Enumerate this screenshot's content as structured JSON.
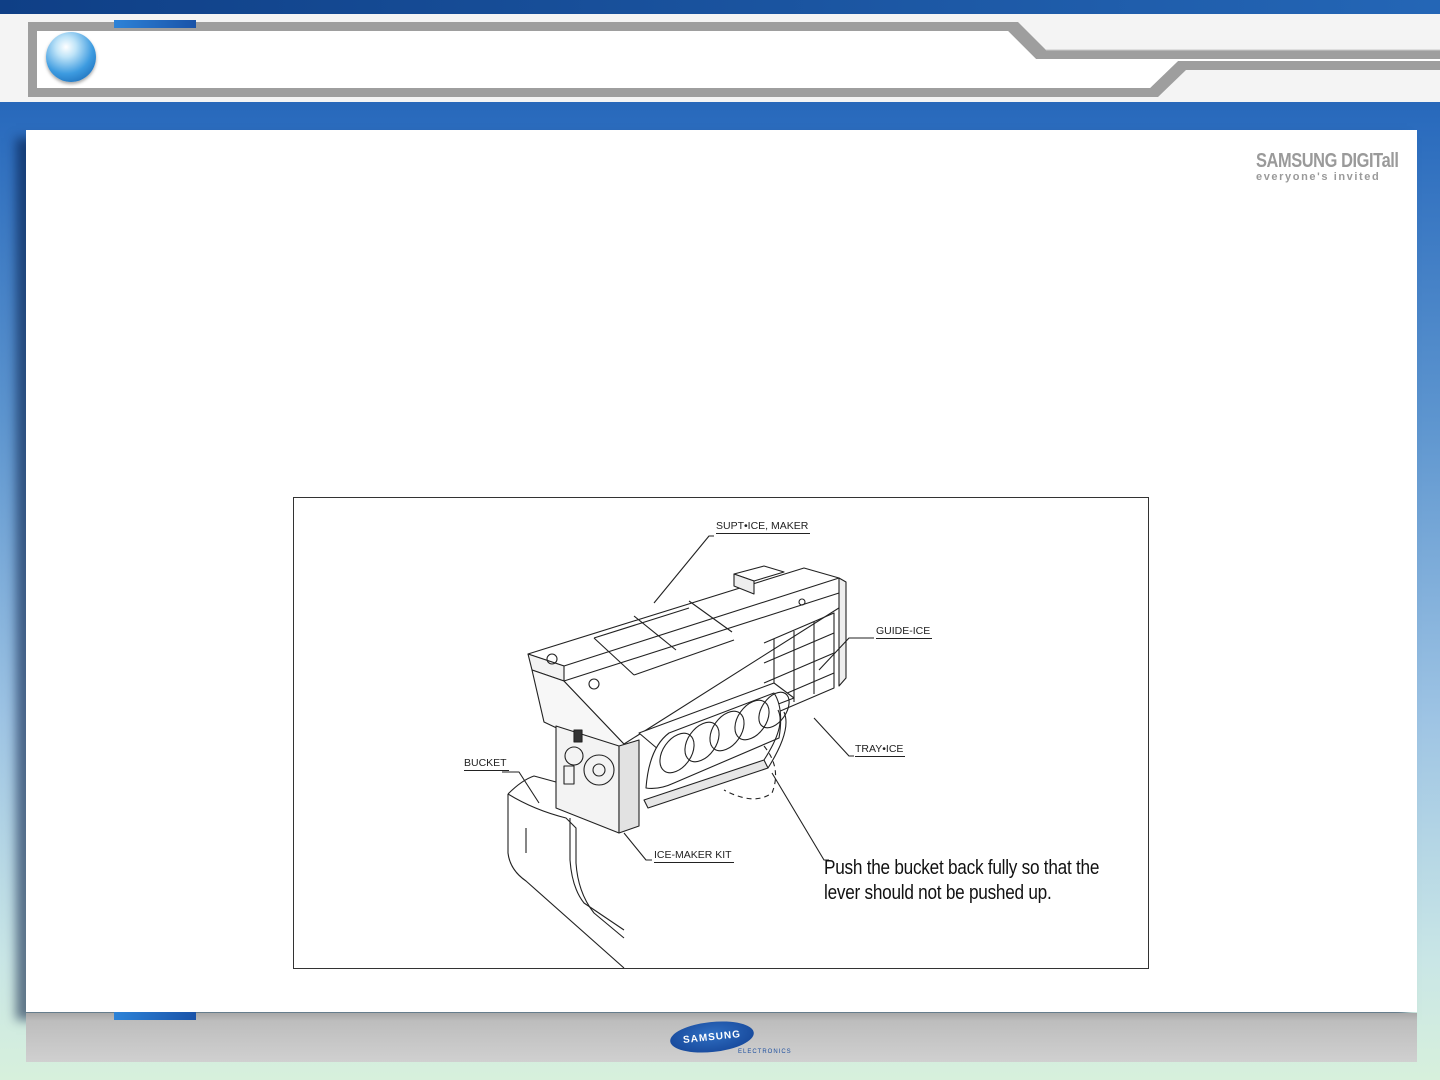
{
  "header": {
    "icon": "blue-orb-icon"
  },
  "branding": {
    "top_logo": "SAMSUNG DIGITall",
    "top_tagline": "everyone's invited",
    "footer_logo": "SAMSUNG",
    "footer_sub": "ELECTRONICS"
  },
  "diagram": {
    "labels": {
      "supt_ice_maker": "SUPT•ICE, MAKER",
      "guide_ice": "GUIDE-ICE",
      "tray_ice": "TRAY•ICE",
      "bucket": "BUCKET",
      "ice_maker_kit": "ICE-MAKER KIT"
    },
    "note": "Push  the bucket back  fully so that the lever should not be pushed up."
  },
  "colors": {
    "accent": "#2d83d8",
    "brand_blue": "#1b57a8",
    "panel": "#ffffff"
  }
}
